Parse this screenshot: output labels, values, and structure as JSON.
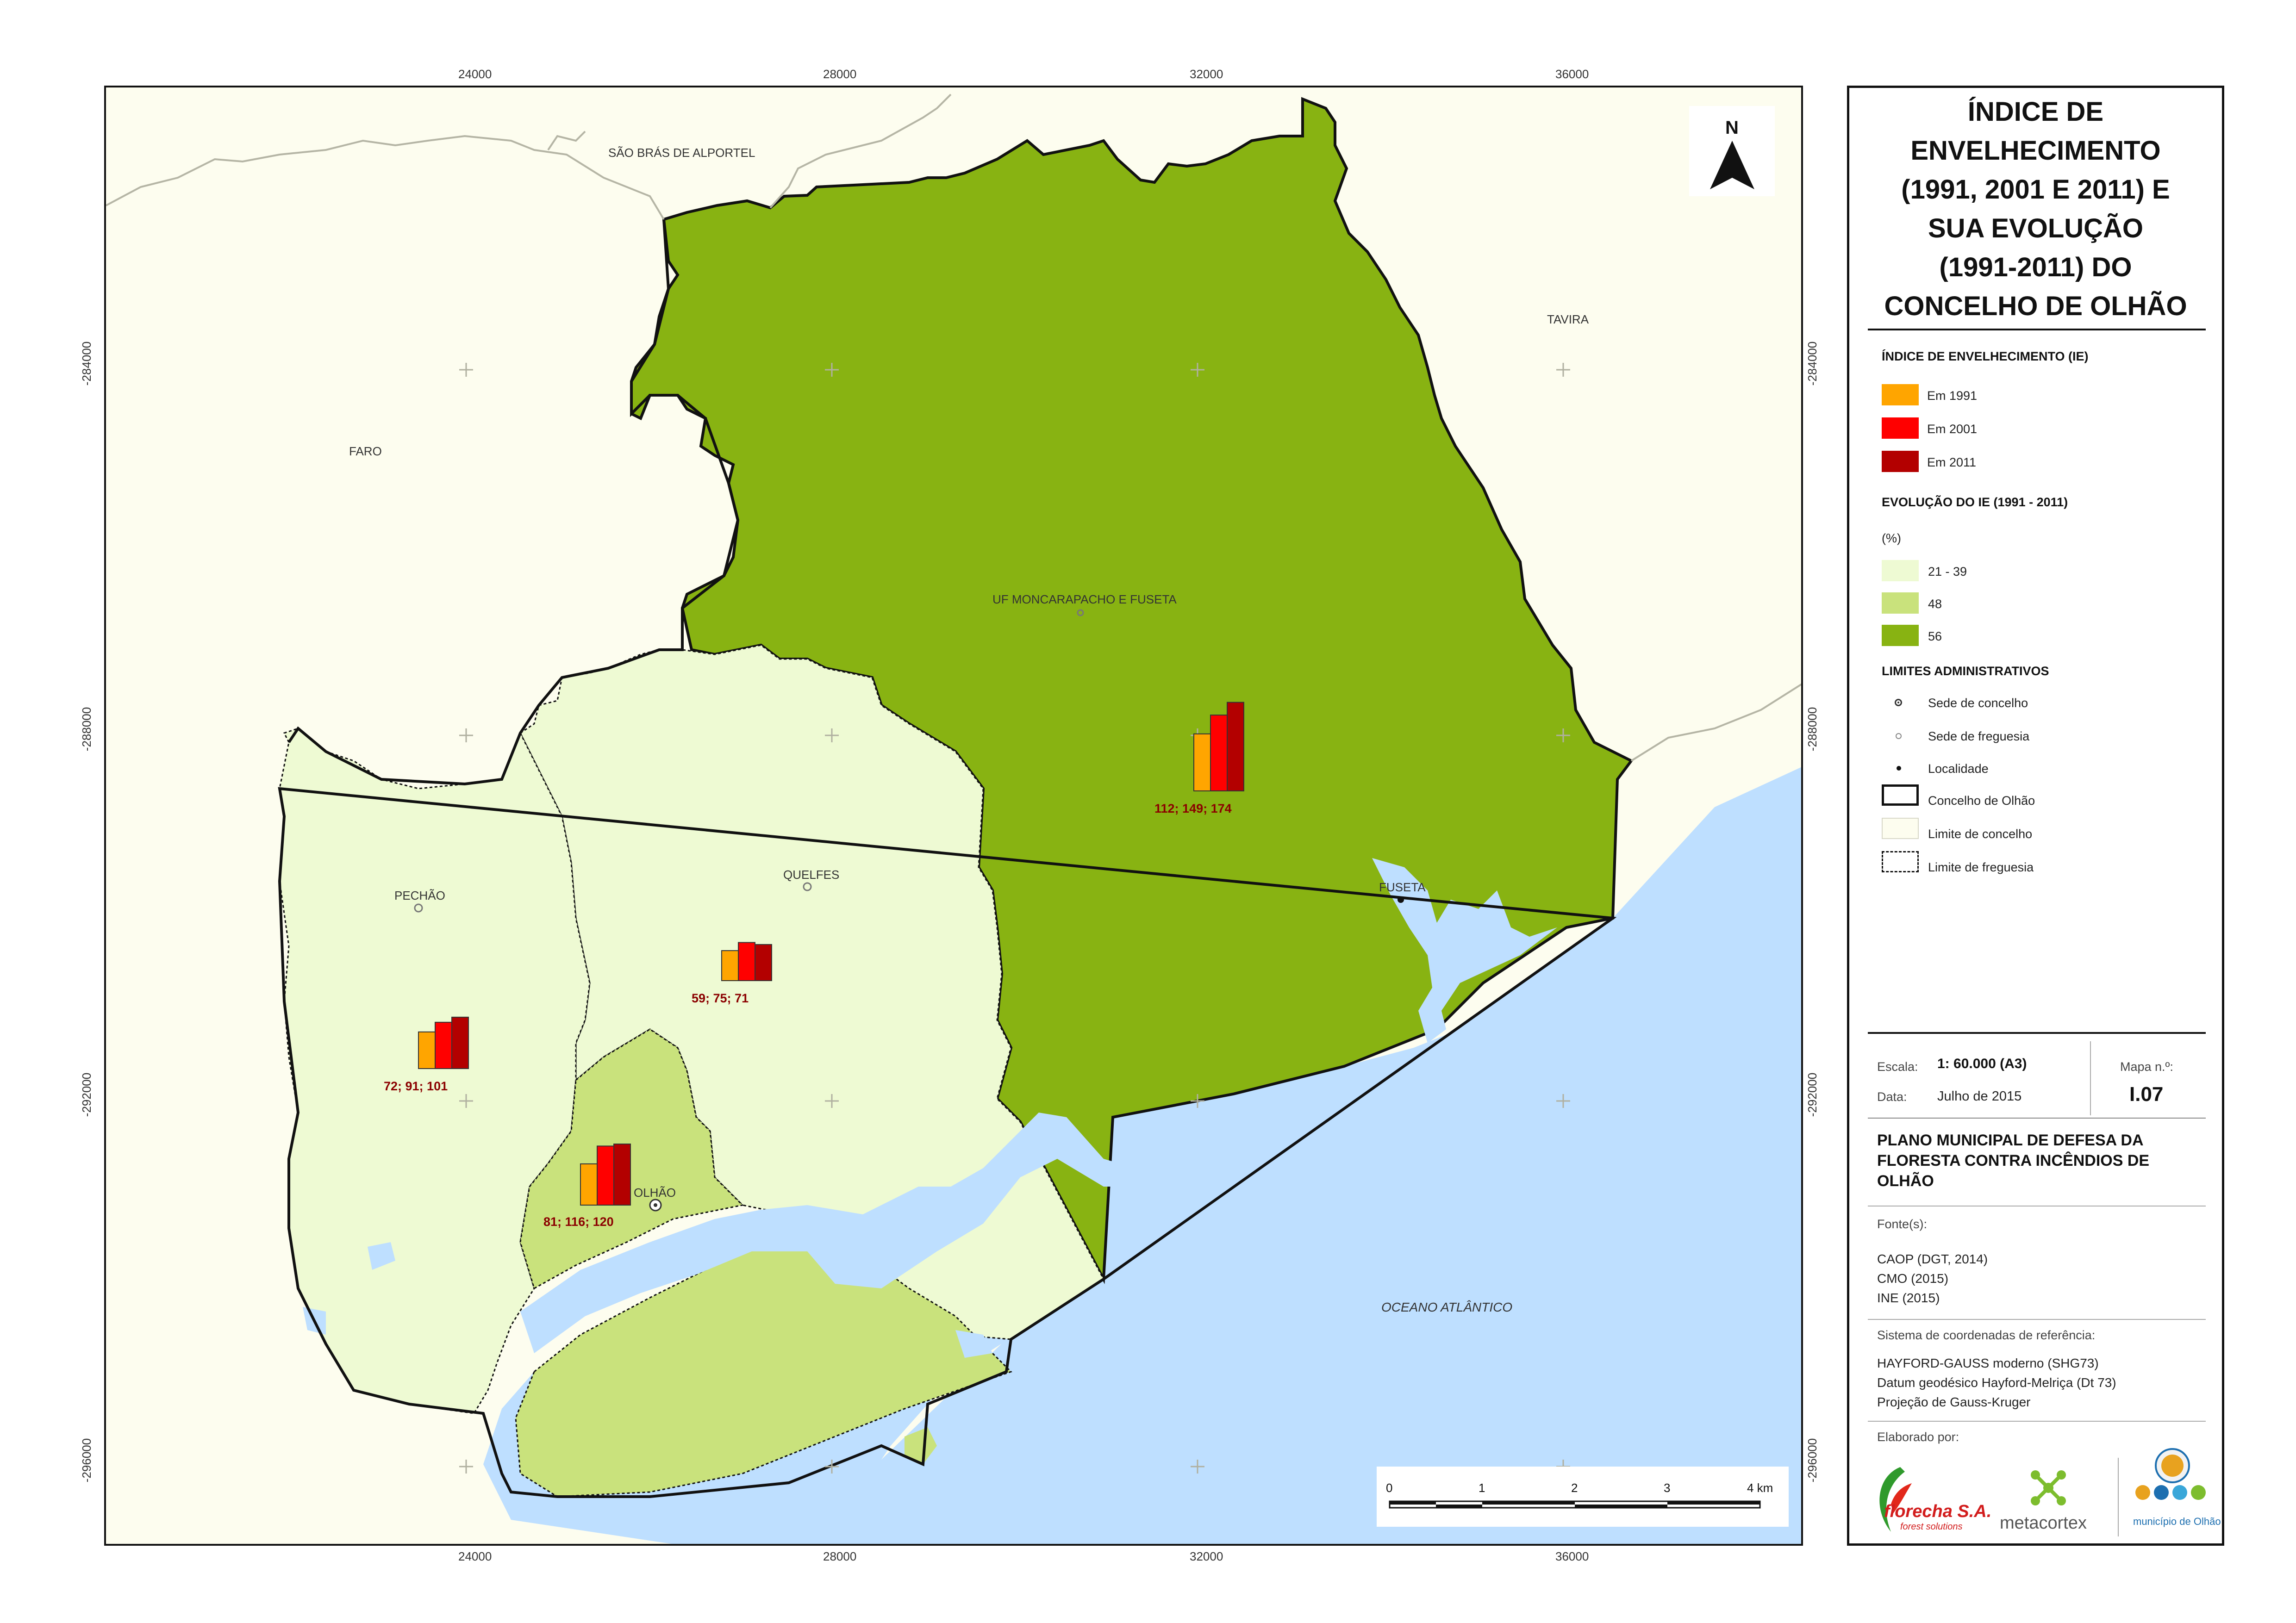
{
  "map": {
    "coords_top": [
      "24000",
      "28000",
      "32000",
      "36000"
    ],
    "coords_bottom": [
      "24000",
      "28000",
      "32000",
      "36000"
    ],
    "coords_left": [
      "-284000",
      "-288000",
      "-292000",
      "-296000"
    ],
    "coords_right": [
      "-284000",
      "-288000",
      "-292000",
      "-296000"
    ],
    "north_label": "N",
    "place_labels": {
      "sao_bras": "SÃO BRÁS DE ALPORTEL",
      "tavira": "TAVIRA",
      "faro": "FARO",
      "moncarapacho": "UF MONCARAPACHO E FUSETA",
      "quelfes": "QUELFES",
      "pechao": "PECHÃO",
      "olhao": "OLHÃO",
      "fuseta": "FUSETA",
      "ocean": "OCEANO ATLÂNTICO"
    },
    "bar_groups": [
      {
        "id": "moncarapacho",
        "values": [
          112,
          149,
          174
        ],
        "label": "112; 149; 174"
      },
      {
        "id": "quelfes",
        "values": [
          59,
          75,
          71
        ],
        "label": "59; 75; 71"
      },
      {
        "id": "pechao",
        "values": [
          72,
          91,
          101
        ],
        "label": "72; 91; 101"
      },
      {
        "id": "olhao",
        "values": [
          81,
          116,
          120
        ],
        "label": "81; 116; 120"
      }
    ],
    "scale_bar": {
      "ticks": [
        "0",
        "1",
        "2",
        "3",
        "4 km"
      ]
    },
    "colors": {
      "ie_1991": "#ffa500",
      "ie_2001": "#ff0000",
      "ie_2011": "#b30000",
      "evo_21_39": "#eefad3",
      "evo_48": "#c9e27c",
      "evo_56": "#88b312",
      "ocean": "#bedfff",
      "outside": "#fdfdef"
    }
  },
  "legend": {
    "title": "ÍNDICE DE ENVELHECIMENTO (1991, 2001 E 2011) E SUA EVOLUÇÃO (1991-2011) DO CONCELHO DE OLHÃO",
    "title_lines": [
      "ÍNDICE DE",
      "ENVELHECIMENTO",
      "(1991, 2001 E 2011) E",
      "SUA EVOLUÇÃO",
      "(1991-2011) DO",
      "CONCELHO DE OLHÃO"
    ],
    "ie_heading": "ÍNDICE DE ENVELHECIMENTO (IE)",
    "ie_items": [
      "Em 1991",
      "Em 2001",
      "Em 2011"
    ],
    "evo_heading": "EVOLUÇÃO DO IE (1991 - 2011)",
    "evo_unit": "(%)",
    "evo_items": [
      "21 - 39",
      "48",
      "56"
    ],
    "limits_heading": "LIMITES ADMINISTRATIVOS",
    "limits_items": [
      "Sede de concelho",
      "Sede de freguesia",
      "Localidade",
      "Concelho de Olhão",
      "Limite de concelho",
      "Limite de freguesia"
    ]
  },
  "info": {
    "scale_label": "Escala:",
    "scale_value": "1: 60.000 (A3)",
    "date_label": "Data:",
    "date_value": "Julho de 2015",
    "map_no_label": "Mapa n.º:",
    "map_no_value": "I.07",
    "plan_title": "PLANO MUNICIPAL DE DEFESA DA FLORESTA CONTRA INCÊNDIOS DE OLHÃO",
    "sources_label": "Fonte(s):",
    "sources": [
      "CAOP (DGT, 2014)",
      "CMO (2015)",
      "INE (2015)"
    ],
    "crs_label": "Sistema de coordenadas de referência:",
    "crs": [
      "HAYFORD-GAUSS moderno (SHG73)",
      "Datum geodésico Hayford-Melriça (Dt 73)",
      "Projeção de Gauss-Kruger"
    ],
    "made_by_label": "Elaborado por:",
    "logos": {
      "florecha": "florecha S.A.",
      "florecha_sub": "forest solutions",
      "metacortex": "metacortex",
      "municipio": "município de Olhão"
    }
  }
}
